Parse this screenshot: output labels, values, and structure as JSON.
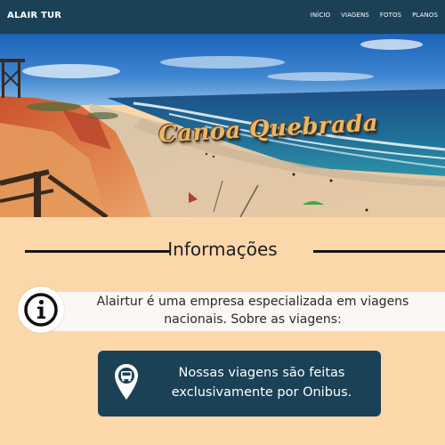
{
  "navbar": {
    "brand": "ALAIR TUR",
    "links": [
      "INÍCIO",
      "VIAGENS",
      "FOTOS",
      "PLANOS"
    ],
    "background_color": "#1a4156"
  },
  "hero": {
    "title": "Canoa Quebrada",
    "image_description_icon": "beach-photo"
  },
  "info_section": {
    "heading": "Informações",
    "info_icon": "info-icon",
    "info_text": "Alairtur é uma empresa especializada em viagens nacionais. Sobre as viagens:"
  },
  "bus_card": {
    "icon": "bus-location-pin-icon",
    "text": "Nossas viagens são feitas exclusivamente por Onibus."
  },
  "colors": {
    "page_background": "#fcd7aa",
    "accent_dark": "#1a4156",
    "hero_title": "#e9b766"
  }
}
